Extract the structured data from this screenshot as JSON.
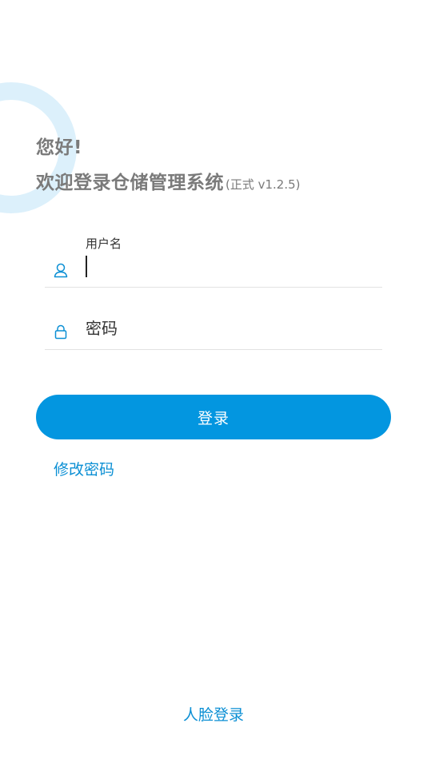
{
  "header": {
    "greeting": "您好!",
    "welcome_title": "欢迎登录仓储管理系统",
    "version": "(正式 v1.2.5)"
  },
  "form": {
    "username_label": "用户名",
    "username_value": "",
    "password_placeholder": "密码",
    "password_value": "",
    "login_label": "登录"
  },
  "links": {
    "change_password": "修改密码",
    "face_login": "人脸登录"
  },
  "colors": {
    "accent": "#0396e0",
    "link": "#0b8fd4",
    "decor_ring": "#dcf0fb",
    "heading_text": "#7a7a7a"
  },
  "icons": {
    "username": "user-icon",
    "password": "lock-icon"
  }
}
